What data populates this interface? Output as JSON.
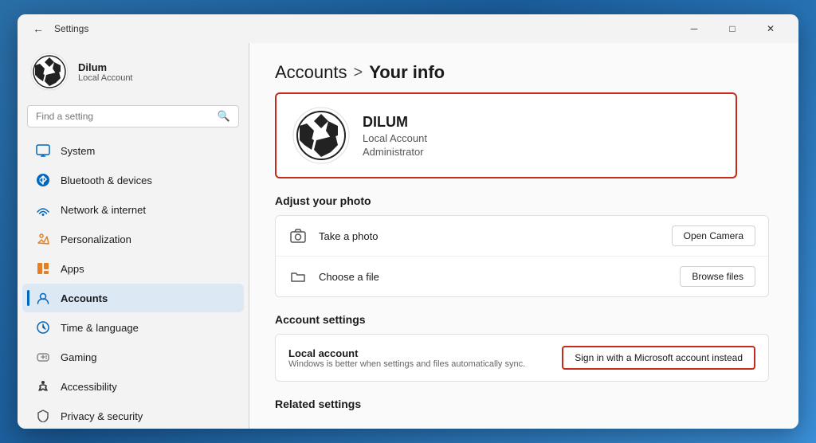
{
  "window": {
    "title": "Settings",
    "controls": {
      "minimize": "─",
      "maximize": "□",
      "close": "✕"
    }
  },
  "sidebar": {
    "profile": {
      "name": "Dilum",
      "type": "Local Account"
    },
    "search": {
      "placeholder": "Find a setting"
    },
    "nav": [
      {
        "id": "system",
        "label": "System",
        "icon": "💻",
        "color": "#0067c0"
      },
      {
        "id": "bluetooth",
        "label": "Bluetooth & devices",
        "icon": "🔵",
        "color": "#0067c0"
      },
      {
        "id": "network",
        "label": "Network & internet",
        "icon": "🌐",
        "color": "#0067c0"
      },
      {
        "id": "personalization",
        "label": "Personalization",
        "icon": "✏️",
        "color": "#e67e22"
      },
      {
        "id": "apps",
        "label": "Apps",
        "icon": "📊",
        "color": "#e67e22"
      },
      {
        "id": "accounts",
        "label": "Accounts",
        "icon": "👤",
        "color": "#0067c0",
        "active": true
      },
      {
        "id": "time",
        "label": "Time & language",
        "icon": "🌍",
        "color": "#0067c0"
      },
      {
        "id": "gaming",
        "label": "Gaming",
        "icon": "🎮",
        "color": "#888"
      },
      {
        "id": "accessibility",
        "label": "Accessibility",
        "icon": "♿",
        "color": "#1a1a1a"
      },
      {
        "id": "privacy",
        "label": "Privacy & security",
        "icon": "🛡️",
        "color": "#555"
      }
    ]
  },
  "content": {
    "breadcrumb_parent": "Accounts",
    "breadcrumb_sep": ">",
    "breadcrumb_current": "Your info",
    "user_card": {
      "name": "DILUM",
      "account_type": "Local Account",
      "role": "Administrator"
    },
    "adjust_photo": {
      "title": "Adjust your photo",
      "rows": [
        {
          "id": "take-photo",
          "icon": "📷",
          "label": "Take a photo",
          "btn": "Open Camera"
        },
        {
          "id": "choose-file",
          "icon": "📁",
          "label": "Choose a file",
          "btn": "Browse files"
        }
      ]
    },
    "account_settings": {
      "title": "Account settings",
      "local_account": {
        "title": "Local account",
        "desc": "Windows is better when settings and files automatically sync.",
        "btn": "Sign in with a Microsoft account instead"
      }
    },
    "related_settings": {
      "title": "Related settings"
    }
  }
}
